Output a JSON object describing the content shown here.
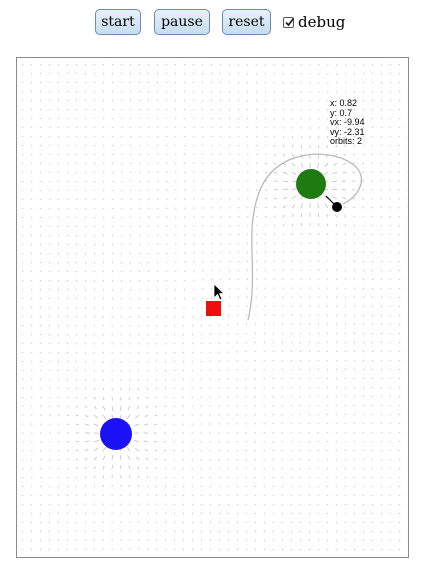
{
  "controls": {
    "start_label": "start",
    "pause_label": "pause",
    "reset_label": "reset",
    "debug_label": "debug",
    "debug_checked": true
  },
  "debug": {
    "x": "x: 0.82",
    "y": "y: 0.7",
    "vx": "vx: -9.94",
    "vy": "vy: -2.31",
    "orbits": "orbits: 2"
  },
  "colors": {
    "attractor_green": "#1f7a12",
    "attractor_blue": "#1a12f5",
    "target_red": "#ef0e0e",
    "particle": "#000000",
    "trail": "#b9b9b9",
    "field": "#b8b8b8"
  }
}
